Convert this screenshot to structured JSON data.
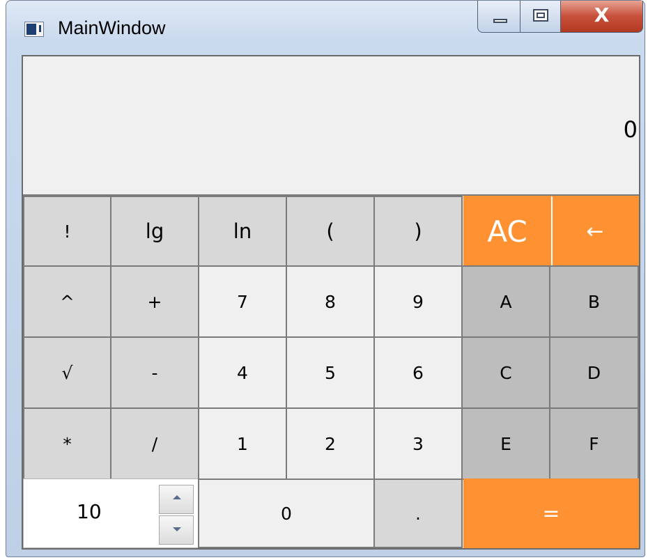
{
  "window": {
    "title": "MainWindow",
    "icon": "app-window-icon",
    "caption_buttons": {
      "minimize_icon": "minimize-icon",
      "maximize_icon": "maximize-icon",
      "close_label": "X"
    }
  },
  "display": {
    "value": "0"
  },
  "keys": {
    "factorial": "!",
    "lg": "lg",
    "ln": "ln",
    "open_paren": "(",
    "close_paren": ")",
    "clear_all": "AC",
    "backspace": "←",
    "power": "^",
    "plus": "+",
    "d7": "7",
    "d8": "8",
    "d9": "9",
    "hA": "A",
    "hB": "B",
    "sqrt": "√",
    "minus": "-",
    "d4": "4",
    "d5": "5",
    "d6": "6",
    "hC": "C",
    "hD": "D",
    "multiply": "*",
    "divide": "/",
    "d1": "1",
    "d2": "2",
    "d3": "3",
    "hE": "E",
    "hF": "F",
    "d0": "0",
    "decimal": ".",
    "equals": "="
  },
  "base_spinner": {
    "value": "10"
  },
  "colors": {
    "accent_orange": "#fe9233",
    "function_key": "#d8d8d8",
    "number_key": "#f0f0f0",
    "hex_key": "#bdbdbd"
  }
}
